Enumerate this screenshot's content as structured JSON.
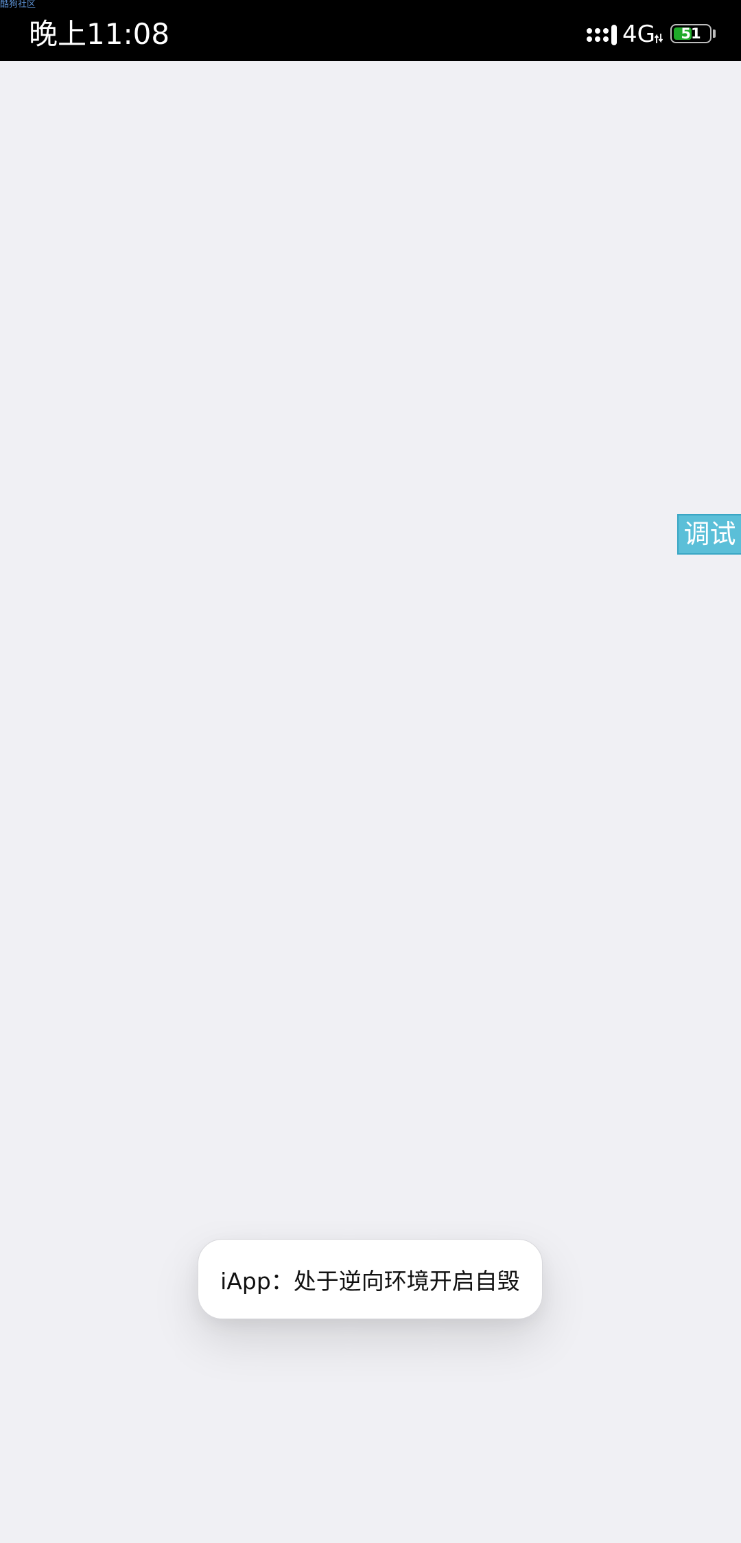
{
  "watermark": {
    "text": "酷狗社区"
  },
  "status_bar": {
    "time": "晚上11:08",
    "network": "4G",
    "battery_level": 51,
    "battery_text": "51",
    "icons": {
      "signal": "cellular-signal-icon",
      "data": "data-activity-icon",
      "battery": "battery-icon"
    },
    "colors": {
      "background": "#000000",
      "battery_fill": "#1faa2a"
    }
  },
  "debug_tab": {
    "label": "调试",
    "color": "#5bbfd8"
  },
  "toast": {
    "message": "iApp：处于逆向环境开启自毁"
  },
  "colors": {
    "page_background": "#f0f0f4"
  }
}
